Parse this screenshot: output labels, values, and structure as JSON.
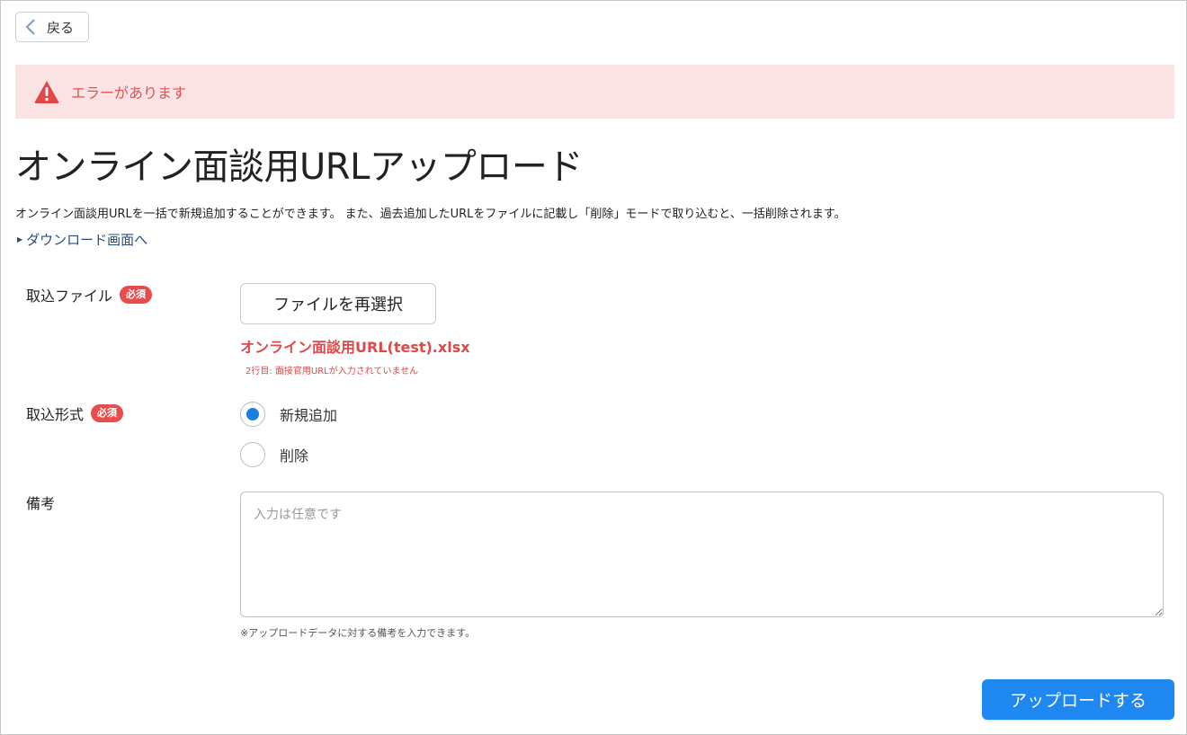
{
  "header": {
    "back_label": "戻る"
  },
  "alert": {
    "message": "エラーがあります"
  },
  "page": {
    "title": "オンライン面談用URLアップロード",
    "description": "オンライン面談用URLを一括で新規追加することができます。 また、過去追加したURLをファイルに記載し「削除」モードで取り込むと、一括削除されます。",
    "download_link": "ダウンロード画面へ"
  },
  "form": {
    "file": {
      "label": "取込ファイル",
      "required_badge": "必須",
      "reselect_button": "ファイルを再選択",
      "file_name": "オンライン面談用URL(test).xlsx",
      "error": "2行目: 面接官用URLが入力されていません"
    },
    "mode": {
      "label": "取込形式",
      "required_badge": "必須",
      "options": [
        {
          "label": "新規追加",
          "selected": true
        },
        {
          "label": "削除",
          "selected": false
        }
      ]
    },
    "notes": {
      "label": "備考",
      "placeholder": "入力は任意です",
      "value": "",
      "hint": "※アップロードデータに対する備考を入力できます。"
    },
    "submit_label": "アップロードする"
  },
  "colors": {
    "accent": "#1e88f0",
    "error": "#e04848",
    "alert_background": "#fbe3e4",
    "required_badge": "#e84c4c",
    "link": "#2a4d7a"
  },
  "icons": {
    "back": "chevron-left-icon",
    "alert": "warning-triangle-icon",
    "link_marker": "triangle-right-icon"
  }
}
